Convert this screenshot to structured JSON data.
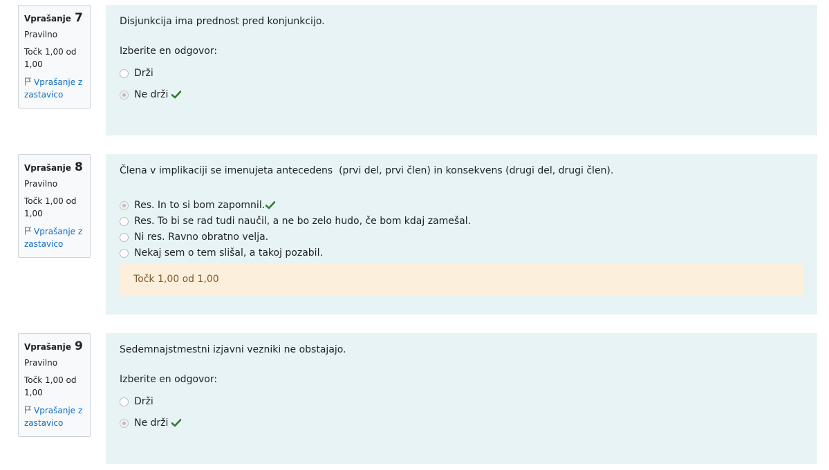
{
  "questions": [
    {
      "label": "Vprašanje",
      "number": "7",
      "state": "Pravilno",
      "grade": "Točk 1,00 od 1,00",
      "flag": "Vprašanje z zastavico",
      "text": "Disjunkcija ima prednost pred konjunkcijo.",
      "prompt": "Izberite en odgovor:",
      "options": [
        {
          "label": "Drži",
          "selected": false,
          "correct": false
        },
        {
          "label": "Ne drži",
          "selected": true,
          "correct": true
        }
      ]
    },
    {
      "label": "Vprašanje",
      "number": "8",
      "state": "Pravilno",
      "grade": "Točk 1,00 od 1,00",
      "flag": "Vprašanje z zastavico",
      "text": "Člena v implikaciji se imenujeta antecedens  (prvi del, prvi člen) in konsekvens (drugi del, drugi člen).",
      "options": [
        {
          "label": "Res. In to si bom zapomnil.",
          "selected": true,
          "correct": true
        },
        {
          "label": "Res. To bi se rad tudi naučil, a ne bo zelo hudo, če bom kdaj zamešal.",
          "selected": false,
          "correct": false
        },
        {
          "label": "Ni res. Ravno obratno velja.",
          "selected": false,
          "correct": false
        },
        {
          "label": "Nekaj sem o tem slišal, a takoj pozabil.",
          "selected": false,
          "correct": false
        }
      ],
      "outcome": "Točk 1,00 od 1,00"
    },
    {
      "label": "Vprašanje",
      "number": "9",
      "state": "Pravilno",
      "grade": "Točk 1,00 od 1,00",
      "flag": "Vprašanje z zastavico",
      "text": "Sedemnajstmestni izjavni vezniki ne obstajajo.",
      "prompt": "Izberite en odgovor:",
      "options": [
        {
          "label": "Drži",
          "selected": false,
          "correct": false
        },
        {
          "label": "Ne drži",
          "selected": true,
          "correct": true
        }
      ]
    }
  ],
  "icons": {
    "flag": "flag-icon",
    "correct": "check-icon",
    "radio": "radio-icon"
  },
  "colors": {
    "content_bg": "#e7f3f5",
    "info_bg": "#f8f9fa",
    "link": "#0f6cbf",
    "correct": "#357a32",
    "outcome_bg": "#fcefdc",
    "outcome_text": "#7d5a29"
  }
}
